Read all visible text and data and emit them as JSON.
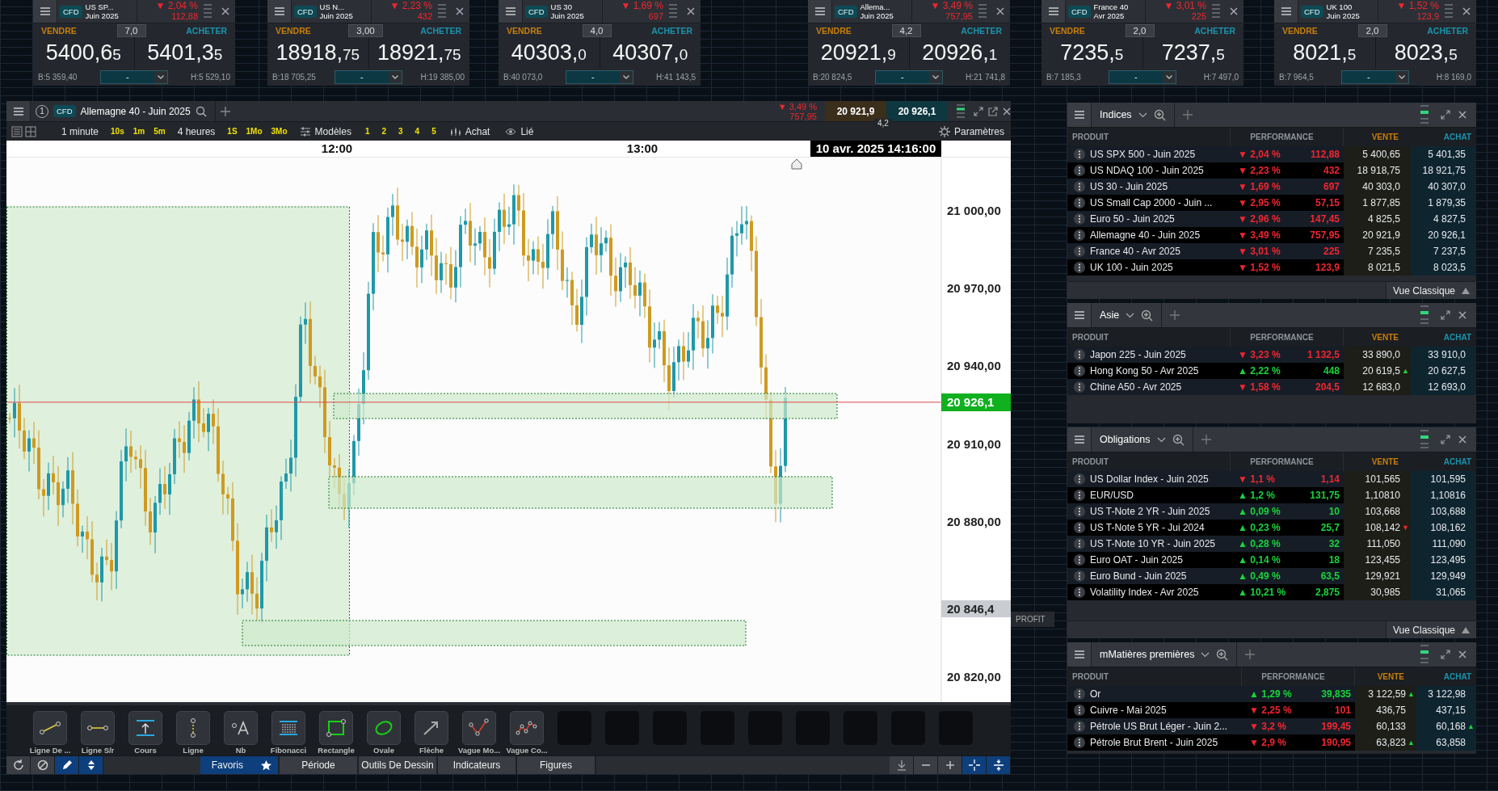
{
  "tickers": [
    {
      "badge": "CFD",
      "symbol": "US SP...",
      "expiry": "Juin 2025",
      "arrow": "▼",
      "falling": true,
      "change_pct": "2,04 %",
      "change": "112,88",
      "sell_label": "VENDRE",
      "buy_label": "ACHETER",
      "spread": "7,0",
      "sell_main": "5400,6",
      "sell_small": "5",
      "buy_main": "5401,3",
      "buy_small": "5",
      "low": "B:5 359,40",
      "high": "H:5 529,10",
      "quantity": "-"
    },
    {
      "badge": "CFD",
      "symbol": "US N...",
      "expiry": "Juin 2025",
      "arrow": "▼",
      "falling": true,
      "change_pct": "2,23 %",
      "change": "432",
      "sell_label": "VENDRE",
      "buy_label": "ACHETER",
      "spread": "3,00",
      "sell_main": "18918,",
      "sell_small": "75",
      "buy_main": "18921,",
      "buy_small": "75",
      "low": "B:18 705,25",
      "high": "H:19 385,00",
      "quantity": "-"
    },
    {
      "badge": "CFD",
      "symbol": "US 30",
      "expiry": "Juin 2025",
      "arrow": "▼",
      "falling": true,
      "change_pct": "1,69 %",
      "change": "697",
      "sell_label": "VENDRE",
      "buy_label": "ACHETER",
      "spread": "4,0",
      "sell_main": "40303,",
      "sell_small": "0",
      "buy_main": "40307,",
      "buy_small": "0",
      "low": "B:40 073,0",
      "high": "H:41 143,5",
      "quantity": "-"
    },
    {
      "badge": "CFD",
      "symbol": "Allema...",
      "expiry": "Juin 2025",
      "arrow": "▼",
      "falling": true,
      "change_pct": "3,49 %",
      "change": "757,95",
      "sell_label": "VENDRE",
      "buy_label": "ACHETER",
      "spread": "4,2",
      "sell_main": "20921,",
      "sell_small": "9",
      "buy_main": "20926,",
      "buy_small": "1",
      "low": "B:20 824,5",
      "high": "H:21 741,8",
      "quantity": "-"
    },
    {
      "badge": "CFD",
      "symbol": "France 40",
      "expiry": "Avr 2025",
      "arrow": "▼",
      "falling": true,
      "change_pct": "3,01 %",
      "change": "225",
      "sell_label": "VENDRE",
      "buy_label": "ACHETER",
      "spread": "2,0",
      "sell_main": "7235,",
      "sell_small": "5",
      "buy_main": "7237,",
      "buy_small": "5",
      "low": "B:7 185,3",
      "high": "H:7 497,0",
      "quantity": "-"
    },
    {
      "badge": "CFD",
      "symbol": "UK 100",
      "expiry": "Juin 2025",
      "arrow": "▼",
      "falling": true,
      "change_pct": "1,52 %",
      "change": "123,9",
      "sell_label": "VENDRE",
      "buy_label": "ACHETER",
      "spread": "2,0",
      "sell_main": "8021,",
      "sell_small": "5",
      "buy_main": "8023,",
      "buy_small": "5",
      "low": "B:7 964,5",
      "high": "H:8 169,0",
      "quantity": "-"
    }
  ],
  "chart": {
    "index": "1",
    "badge": "CFD",
    "title": "Allemagne 40 - Juin 2025",
    "arrow": "▼",
    "falling": true,
    "change_pct": "3,49 %",
    "change": "757,95",
    "sell": "20 921,9",
    "buy": "20 926,1",
    "spread": "4,2",
    "timeframe": "1 minute",
    "quick_timeframes": [
      "10s",
      "1m",
      "5m"
    ],
    "period": "4 heures",
    "quick_periods": [
      "1S",
      "1Mo",
      "3Mo"
    ],
    "templates": "Modèles",
    "template_slots": [
      "1",
      "2",
      "3",
      "4",
      "5"
    ],
    "order": "Achat",
    "link": "Lié",
    "settings": "Paramètres",
    "time_labels": [
      "12:00",
      "13:00"
    ],
    "cursor_time": "10 avr. 2025 14:16:00",
    "price_labels": [
      "21 000,00",
      "20 970,00",
      "20 940,00",
      "20 910,00",
      "20 880,00",
      "20 820,00"
    ],
    "current_price": "20 926,1",
    "marker_price": "20 846,4"
  },
  "hidden_panel_label": "PROFIT",
  "drawing_tools": [
    {
      "kind": "line",
      "label": "Ligne De ..."
    },
    {
      "kind": "sr-line",
      "label": "Ligne S/r"
    },
    {
      "kind": "price",
      "label": "Cours"
    },
    {
      "kind": "vline",
      "label": "Ligne"
    },
    {
      "kind": "note",
      "label": "Nb"
    },
    {
      "kind": "fibonacci",
      "label": "Fibonacci"
    },
    {
      "kind": "rectangle",
      "label": "Rectangle"
    },
    {
      "kind": "oval",
      "label": "Ovale"
    },
    {
      "kind": "arrow",
      "label": "Flèche"
    },
    {
      "kind": "wave",
      "label": "Vague Mo..."
    },
    {
      "kind": "wave2",
      "label": "Vague Co..."
    }
  ],
  "left_toggles": [
    {
      "kind": "refresh",
      "selected": false
    },
    {
      "kind": "ban",
      "selected": false
    },
    {
      "kind": "pencil",
      "selected": true
    },
    {
      "kind": "sort",
      "selected": true
    }
  ],
  "bottom_tabs": [
    {
      "label": "Favoris",
      "selected": true
    },
    {
      "label": "Période",
      "selected": false
    },
    {
      "label": "Outils De Dessin",
      "selected": false
    },
    {
      "label": "Indicateurs",
      "selected": false
    },
    {
      "label": "Figures",
      "selected": false
    }
  ],
  "right_toggles": [
    {
      "kind": "tool",
      "selected": false
    },
    {
      "kind": "minus",
      "selected": false
    },
    {
      "kind": "plus",
      "selected": false
    },
    {
      "kind": "crosshair",
      "selected": true
    },
    {
      "kind": "split",
      "selected": true
    }
  ],
  "panels": [
    {
      "title": "Indices",
      "columns": {
        "product": "PRODUIT",
        "performance": "PERFORMANCE",
        "sell": "VENTE",
        "buy": "ACHAT"
      },
      "footer": "Vue Classique",
      "rows": [
        {
          "name": "US SPX 500 - Juin 2025",
          "arrow": "▼",
          "falling": true,
          "pct": "2,04 %",
          "change": "112,88",
          "sell": "5 400,65",
          "buy": "5 401,35"
        },
        {
          "name": "US NDAQ 100 - Juin 2025",
          "arrow": "▼",
          "falling": true,
          "pct": "2,23 %",
          "change": "432",
          "sell": "18 918,75",
          "buy": "18 921,75"
        },
        {
          "name": "US 30 - Juin 2025",
          "arrow": "▼",
          "falling": true,
          "pct": "1,69 %",
          "change": "697",
          "sell": "40 303,0",
          "buy": "40 307,0"
        },
        {
          "name": "US Small Cap 2000 - Juin ...",
          "arrow": "▼",
          "falling": true,
          "pct": "2,95 %",
          "change": "57,15",
          "sell": "1 877,85",
          "buy": "1 879,35"
        },
        {
          "name": "Euro 50 - Juin 2025",
          "arrow": "▼",
          "falling": true,
          "pct": "2,96 %",
          "change": "147,45",
          "sell": "4 825,5",
          "buy": "4 827,5"
        },
        {
          "name": "Allemagne 40 - Juin 2025",
          "arrow": "▼",
          "falling": true,
          "pct": "3,49 %",
          "change": "757,95",
          "sell": "20 921,9",
          "buy": "20 926,1"
        },
        {
          "name": "France 40 - Avr 2025",
          "arrow": "▼",
          "falling": true,
          "pct": "3,01 %",
          "change": "225",
          "sell": "7 235,5",
          "buy": "7 237,5"
        },
        {
          "name": "UK 100 - Juin 2025",
          "arrow": "▼",
          "falling": true,
          "pct": "1,52 %",
          "change": "123,9",
          "sell": "8 021,5",
          "buy": "8 023,5"
        }
      ]
    },
    {
      "title": "Asie",
      "columns": {
        "product": "PRODUIT",
        "performance": "PERFORMANCE",
        "sell": "VENTE",
        "buy": "ACHAT"
      },
      "rows": [
        {
          "name": "Japon 225 - Juin 2025",
          "arrow": "▼",
          "falling": true,
          "pct": "3,23 %",
          "change": "1 132,5",
          "sell": "33 890,0",
          "buy": "33 910,0"
        },
        {
          "name": "Hong Kong 50 - Avr 2025",
          "arrow": "▲",
          "falling": false,
          "pct": "2,22 %",
          "change": "448",
          "sell": "20 619,5",
          "sell_tick": {
            "arrow": "▲",
            "falling": false
          },
          "buy": "20 627,5"
        },
        {
          "name": "Chine A50 - Avr 2025",
          "arrow": "▼",
          "falling": true,
          "pct": "1,58 %",
          "change": "204,5",
          "sell": "12 683,0",
          "buy": "12 693,0"
        }
      ]
    },
    {
      "title": "Obligations",
      "columns": {
        "product": "PRODUIT",
        "performance": "PERFORMANCE",
        "sell": "VENTE",
        "buy": "ACHAT"
      },
      "footer": "Vue Classique",
      "rows": [
        {
          "name": "US Dollar Index - Juin 2025",
          "arrow": "▼",
          "falling": true,
          "pct": "1,1 %",
          "change": "1,14",
          "sell": "101,565",
          "buy": "101,595"
        },
        {
          "name": "EUR/USD",
          "arrow": "▲",
          "falling": false,
          "pct": "1,2 %",
          "change": "131,75",
          "sell": "1,10810",
          "buy": "1,10816"
        },
        {
          "name": "US T-Note 2 YR - Juin 2025",
          "arrow": "▲",
          "falling": false,
          "pct": "0,09 %",
          "change": "10",
          "sell": "103,668",
          "buy": "103,688"
        },
        {
          "name": "US T-Note 5 YR - Jui 2024",
          "arrow": "▲",
          "falling": false,
          "pct": "0,23 %",
          "change": "25,7",
          "sell": "108,142",
          "sell_tick": {
            "arrow": "▼",
            "falling": true
          },
          "buy": "108,162"
        },
        {
          "name": "US T-Note 10 YR - Juin 2025",
          "arrow": "▲",
          "falling": false,
          "pct": "0,28 %",
          "change": "32",
          "sell": "111,050",
          "buy": "111,090"
        },
        {
          "name": "Euro OAT - Juin 2025",
          "arrow": "▲",
          "falling": false,
          "pct": "0,14 %",
          "change": "18",
          "sell": "123,455",
          "buy": "123,495"
        },
        {
          "name": "Euro Bund - Juin 2025",
          "arrow": "▲",
          "falling": false,
          "pct": "0,49 %",
          "change": "63,5",
          "sell": "129,921",
          "buy": "129,949"
        },
        {
          "name": "Volatility Index - Avr 2025",
          "arrow": "▲",
          "falling": false,
          "pct": "10,21 %",
          "change": "2,875",
          "sell": "30,985",
          "buy": "31,065"
        }
      ]
    },
    {
      "title": "mMatières premières",
      "columns": {
        "product": "PRODUIT",
        "performance": "PERFORMANCE",
        "sell": "VENTE",
        "buy": "ACHAT"
      },
      "rows": [
        {
          "name": "Or",
          "arrow": "▲",
          "falling": false,
          "pct": "1,29 %",
          "change": "39,835",
          "sell": "3 122,59",
          "sell_tick": {
            "arrow": "▲",
            "falling": false
          },
          "buy": "3 122,98"
        },
        {
          "name": "Cuivre - Mai 2025",
          "arrow": "▼",
          "falling": true,
          "pct": "2,25 %",
          "change": "101",
          "sell": "436,75",
          "buy": "437,15"
        },
        {
          "name": "Pétrole US Brut Léger - Juin 2...",
          "arrow": "▼",
          "falling": true,
          "pct": "3,2 %",
          "change": "199,45",
          "sell": "60,133",
          "buy": "60,168",
          "buy_tick": {
            "arrow": "▲",
            "falling": false
          }
        },
        {
          "name": "Pétrole Brut Brent - Juin 2025",
          "arrow": "▼",
          "falling": true,
          "pct": "2,9 %",
          "change": "190,95",
          "sell": "63,823",
          "sell_tick": {
            "arrow": "▲",
            "falling": false
          },
          "buy": "63,858"
        }
      ]
    }
  ]
}
